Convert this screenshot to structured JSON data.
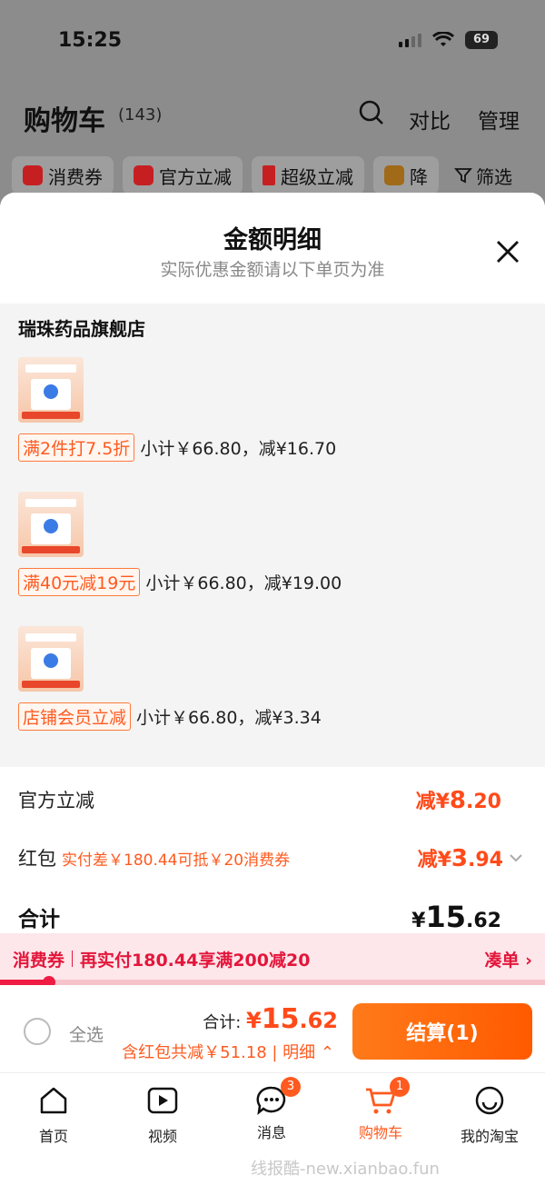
{
  "status_bar": {
    "time": "15:25",
    "battery": "69"
  },
  "background": {
    "title": "购物车",
    "count": "(143)",
    "compare": "对比",
    "manage": "管理",
    "chips": [
      "消费券",
      "官方立减",
      "超级立减",
      "降"
    ],
    "filter": "筛选"
  },
  "sheet": {
    "title": "金额明细",
    "subtitle": "实际优惠金额请以下单页为准",
    "store_name": "瑞珠药品旗舰店",
    "items": [
      {
        "promo": "满2件打7.5折",
        "calc": "小计￥66.80，减¥16.70"
      },
      {
        "promo": "满40元减19元",
        "calc": "小计￥66.80，减¥19.00"
      },
      {
        "promo": "店铺会员立减",
        "calc": "小计￥66.80，减¥3.34"
      }
    ],
    "summary": {
      "official_label": "官方立减",
      "official_prefix": "减¥",
      "official_int": "8",
      "official_dec": ".20",
      "redpacket_label": "红包",
      "redpacket_hint": "实付差￥180.44可抵￥20消费券",
      "redpacket_prefix": "减¥",
      "redpacket_int": "3",
      "redpacket_dec": ".94",
      "total_label": "合计",
      "total_prefix": "¥",
      "total_int": "15",
      "total_dec": ".62"
    },
    "coupon_bar": {
      "tag": "消费券",
      "text": "再实付180.44享满200减20",
      "link": "凑单",
      "progress": 0.09
    },
    "checkout": {
      "select_all": "全选",
      "total_label": "合计:",
      "total_prefix": "¥",
      "total_int": "15",
      "total_dec": ".62",
      "discount_detail": "含红包共减￥51.18 | 明细",
      "pay_button": "结算(1)"
    }
  },
  "tabbar": [
    {
      "label": "首页",
      "icon": "home-icon"
    },
    {
      "label": "视频",
      "icon": "video-icon"
    },
    {
      "label": "消息",
      "icon": "message-icon",
      "badge": "3"
    },
    {
      "label": "购物车",
      "icon": "cart-icon",
      "badge": "1",
      "active": true
    },
    {
      "label": "我的淘宝",
      "icon": "profile-icon"
    }
  ],
  "watermark": "线报酷-new.xianbao.fun",
  "colors": {
    "accent": "#ff5a1f",
    "coupon_red": "#e3163b"
  }
}
